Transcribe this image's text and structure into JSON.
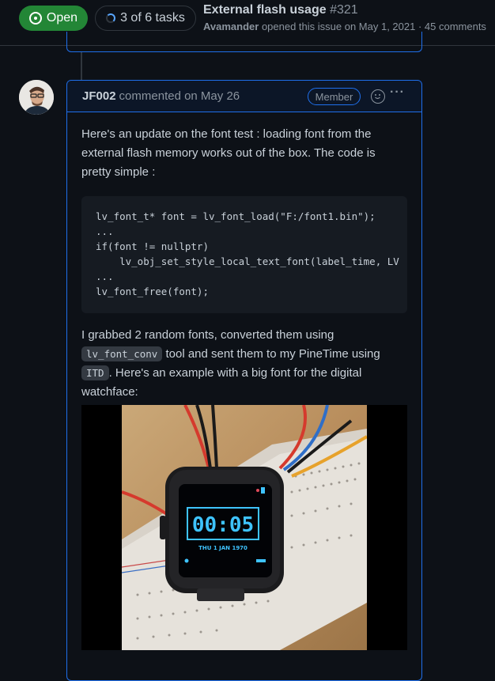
{
  "header": {
    "state": "Open",
    "tasks": "3 of 6 tasks",
    "title": "External flash usage",
    "number": "#321",
    "meta_author": "Avamander",
    "meta_text": " opened this issue on May 1, 2021 · 45 comments"
  },
  "comment": {
    "author": "JF002",
    "timestamp": "commented on May 26",
    "badge": "Member",
    "intro": "Here's an update on the font test : loading font from the external flash memory works out of the box. The code is pretty simple :",
    "code": "lv_font_t* font = lv_font_load(\"F:/font1.bin\");\n...\nif(font != nullptr)\n    lv_obj_set_style_local_text_font(label_time, LV\n...\nlv_font_free(font);",
    "para2_a": "I grabbed 2 random fonts, converted them using ",
    "para2_code1": "lv_font_conv",
    "para2_b": " tool and sent them to my PineTime using ",
    "para2_code2": "ITD",
    "para2_c": ". Here's an example with a big font for the digital watchface:"
  },
  "watch": {
    "time": "00:05",
    "date": "THU 1 JAN 1970"
  },
  "colors": {
    "open_green": "#238636",
    "accent_blue": "#1f6feb",
    "watch_screen": "#3ec3ff"
  }
}
